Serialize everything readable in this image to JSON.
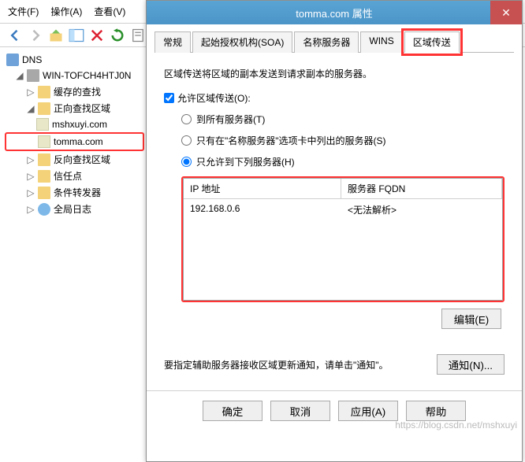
{
  "menubar": {
    "file": "文件(F)",
    "action": "操作(A)",
    "view": "查看(V)"
  },
  "tree": {
    "root": "DNS",
    "server": "WIN-TOFCH4HTJ0N",
    "cached": "缓存的查找",
    "fwd_zones": "正向查找区域",
    "zone1": "mshxuyi.com",
    "zone2": "tomma.com",
    "rev_zones": "反向查找区域",
    "trust": "信任点",
    "cond_fwd": "条件转发器",
    "global_log": "全局日志"
  },
  "dialog": {
    "title": "tomma.com 属性",
    "tabs": {
      "general": "常规",
      "soa": "起始授权机构(SOA)",
      "ns": "名称服务器",
      "wins": "WINS",
      "zt": "区域传送"
    },
    "desc": "区域传送将区域的副本发送到请求副本的服务器。",
    "allow_zt": "允许区域传送(O):",
    "radio_all": "到所有服务器(T)",
    "radio_ns": "只有在\"名称服务器\"选项卡中列出的服务器(S)",
    "radio_only": "只允许到下列服务器(H)",
    "col_ip": "IP 地址",
    "col_fqdn": "服务器 FQDN",
    "rows": [
      {
        "ip": "192.168.0.6",
        "fqdn": "<无法解析>"
      }
    ],
    "edit_btn": "编辑(E)",
    "notify_text": "要指定辅助服务器接收区域更新通知，请单击\"通知\"。",
    "notify_btn": "通知(N)...",
    "ok": "确定",
    "cancel": "取消",
    "apply": "应用(A)",
    "help": "帮助"
  },
  "watermark": "https://blog.csdn.net/mshxuyi"
}
